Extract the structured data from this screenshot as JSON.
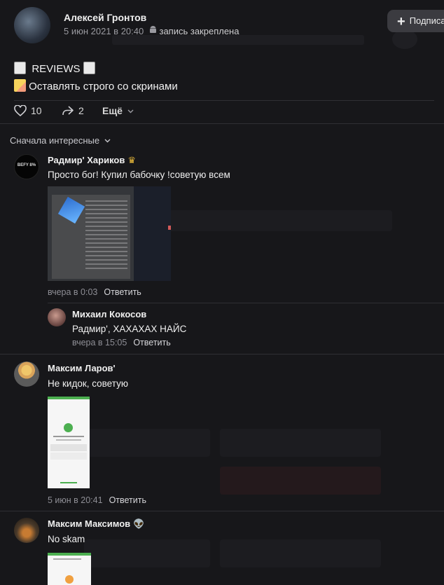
{
  "post": {
    "author": "Алексей Гронтов",
    "date": "5 июн 2021 в 20:40",
    "pinned": "запись закреплена",
    "subscribe_label": "Подписаться",
    "line1": "REVIEWS",
    "line2": "Оставлять строго со скринами",
    "likes": "10",
    "shares": "2",
    "more_label": "Ещё"
  },
  "sort_label": "Сначала интересные",
  "comments": [
    {
      "avatar_text": "BEFY 8%",
      "name": "Радмир' Хариков",
      "text": "Просто бог! Купил бабочку !советую всем",
      "time": "вчера в 0:03",
      "reply_label": "Ответить"
    },
    {
      "name": "Михаил Кокосов",
      "text": "Радмир', ХАХАХАХ НАЙС",
      "time": "вчера в 15:05",
      "reply_label": "Ответить"
    },
    {
      "name": "Максим Ларов'",
      "text": "Не кидок, советую",
      "time": "5 июн в 20:41",
      "reply_label": "Ответить"
    },
    {
      "name": "Максим Максимов",
      "text": "No skam"
    }
  ],
  "colors": {
    "background": "#17171a",
    "accent_green": "#4caf50"
  }
}
